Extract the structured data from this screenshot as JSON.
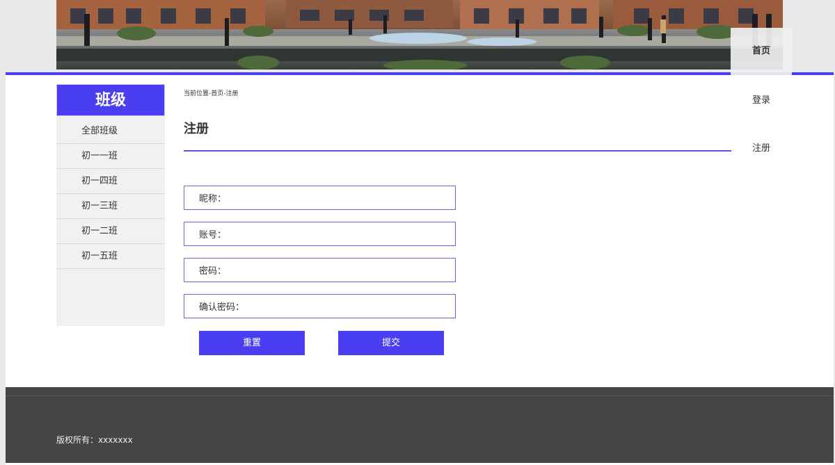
{
  "nav": {
    "home": "首页",
    "login": "登录",
    "register": "注册"
  },
  "sidebar": {
    "title": "班级",
    "items": [
      {
        "label": "全部班级"
      },
      {
        "label": "初一一班"
      },
      {
        "label": "初一四班"
      },
      {
        "label": "初一三班"
      },
      {
        "label": "初一二班"
      },
      {
        "label": "初一五班"
      }
    ]
  },
  "main": {
    "breadcrumb": "当前位置-首页-注册",
    "title": "注册",
    "fields": [
      {
        "label": "昵称：",
        "value": ""
      },
      {
        "label": "账号：",
        "value": ""
      },
      {
        "label": "密码：",
        "value": ""
      },
      {
        "label": "确认密码：",
        "value": ""
      }
    ],
    "reset_label": "重置",
    "submit_label": "提交"
  },
  "footer": {
    "copyright": "版权所有：xxxxxxx"
  },
  "colors": {
    "accent": "#4a3ff0",
    "footer_bg": "#454545"
  }
}
